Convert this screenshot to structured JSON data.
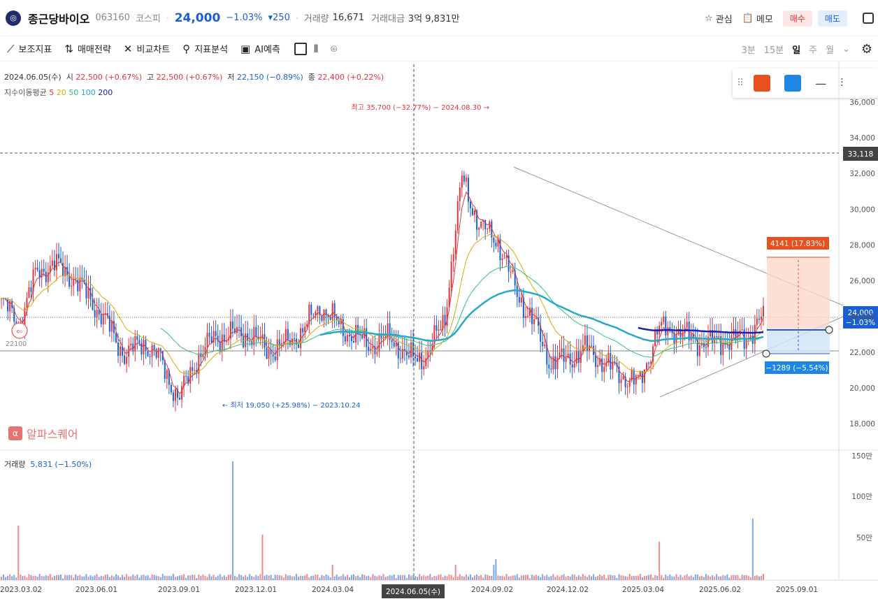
{
  "header": {
    "name": "종근당바이오",
    "code": "063160",
    "market": "코스피",
    "price": "24,000",
    "change_pct": "−1.03%",
    "change_abs": "▾250",
    "volume_label": "거래량",
    "volume": "16,671",
    "amount_label": "거래대금",
    "amount": "3억 9,831만",
    "watch_label": "관심",
    "memo_label": "메모",
    "buy_label": "매수",
    "sell_label": "매도"
  },
  "toolbar": {
    "tools": [
      "보조지표",
      "매매전략",
      "비교차트",
      "지표분석",
      "AI예측"
    ],
    "periods": [
      "3분",
      "15분",
      "일",
      "주",
      "월"
    ],
    "active_period": "일"
  },
  "ohlc": {
    "date": "2024.06.05(수)",
    "open_label": "시",
    "open": "22,500 (+0.67%)",
    "high_label": "고",
    "high": "22,500 (+0.67%)",
    "low_label": "저",
    "low": "22,150 (−0.89%)",
    "close_label": "종",
    "close": "22,400 (+0.22%)"
  },
  "ema": {
    "label": "지수이동평균",
    "periods": [
      "5",
      "20",
      "50",
      "100",
      "200"
    ],
    "colors": [
      "#e0343b",
      "#e0a800",
      "#2ec27e",
      "#26a9c9",
      "#1a23b0"
    ]
  },
  "annotations": {
    "high": "최고 35,700 (−32.77%) − 2024.08.30 →",
    "low": "← 최저 19,050 (+25.98%) − 2023.10.24",
    "crosshair_price": "33,118",
    "current_price": "24,000",
    "current_pct": "−1.03%",
    "target_up": "4141 (17.83%)",
    "target_down": "−1289 (−5.54%)",
    "left_marker": "22100",
    "crosshair_date": "2024.06.05(수)"
  },
  "volume": {
    "label": "거래량",
    "value": "5,831 (−1.50%)"
  },
  "watermark": "알파스퀘어",
  "chart_data": {
    "type": "candlestick",
    "price_axis": [
      "36,000",
      "34,000",
      "32,000",
      "30,000",
      "28,000",
      "26,000",
      "24,000",
      "22,000",
      "20,000",
      "18,000"
    ],
    "volume_axis": [
      "150만",
      "100만",
      "50만"
    ],
    "x_labels": [
      "2023.03.02",
      "2023.06.01",
      "2023.09.01",
      "2023.12.01",
      "2024.03.04",
      "2024.09.02",
      "2024.12.02",
      "2025.03.04",
      "2025.06.02",
      "2025.09.01"
    ],
    "ylim": [
      17000,
      37000
    ],
    "close_series": [
      24800,
      23600,
      26500,
      26900,
      26200,
      25000,
      23500,
      21800,
      22600,
      21500,
      19300,
      21600,
      22800,
      23000,
      23000,
      22100,
      22400,
      23200,
      24600,
      23500,
      22800,
      22400,
      22800,
      21600,
      21800,
      23800,
      31800,
      29000,
      28300,
      25500,
      23700,
      21400,
      21600,
      22200,
      21400,
      20700,
      20200,
      23200,
      23300,
      22700,
      22500,
      22700,
      22800,
      24000
    ]
  }
}
